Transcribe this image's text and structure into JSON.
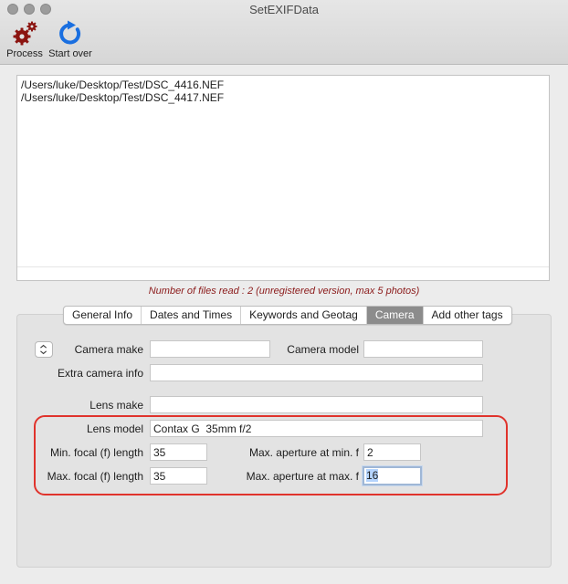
{
  "window": {
    "title": "SetEXIFData"
  },
  "toolbar": {
    "process_label": "Process",
    "start_over_label": "Start over"
  },
  "files": [
    "/Users/luke/Desktop/Test/DSC_4416.NEF",
    "/Users/luke/Desktop/Test/DSC_4417.NEF"
  ],
  "status": "Number of files read : 2 (unregistered version, max 5 photos)",
  "tabs": {
    "general_info": "General Info",
    "dates_and_times": "Dates and Times",
    "keywords_and_geotag": "Keywords and Geotag",
    "camera": "Camera",
    "add_other_tags": "Add other tags",
    "active": "Camera"
  },
  "camera": {
    "camera_make_label": "Camera make",
    "camera_make_value": "",
    "camera_model_label": "Camera model",
    "camera_model_value": "",
    "extra_camera_info_label": "Extra camera info",
    "extra_camera_info_value": "",
    "lens_make_label": "Lens make",
    "lens_make_value": "",
    "lens_model_label": "Lens model",
    "lens_model_value": "Contax G  35mm f/2",
    "min_focal_label": "Min. focal (f) length",
    "min_focal_value": "35",
    "max_focal_label": "Max. focal (f) length",
    "max_focal_value": "35",
    "max_aperture_min_label": "Max. aperture at min. f",
    "max_aperture_min_value": "2",
    "max_aperture_max_label": "Max. aperture at max. f",
    "max_aperture_max_value": "16"
  },
  "colors": {
    "status_text": "#8b1a1a",
    "highlight_box": "#e0332c",
    "process_icon": "#8b1410",
    "start_over_icon": "#1a6fe0",
    "active_tab": "#8c8c8c"
  },
  "icons": {
    "process": "gears-icon",
    "start_over": "refresh-arrow-icon",
    "popup": "up-down-chevron-icon"
  }
}
